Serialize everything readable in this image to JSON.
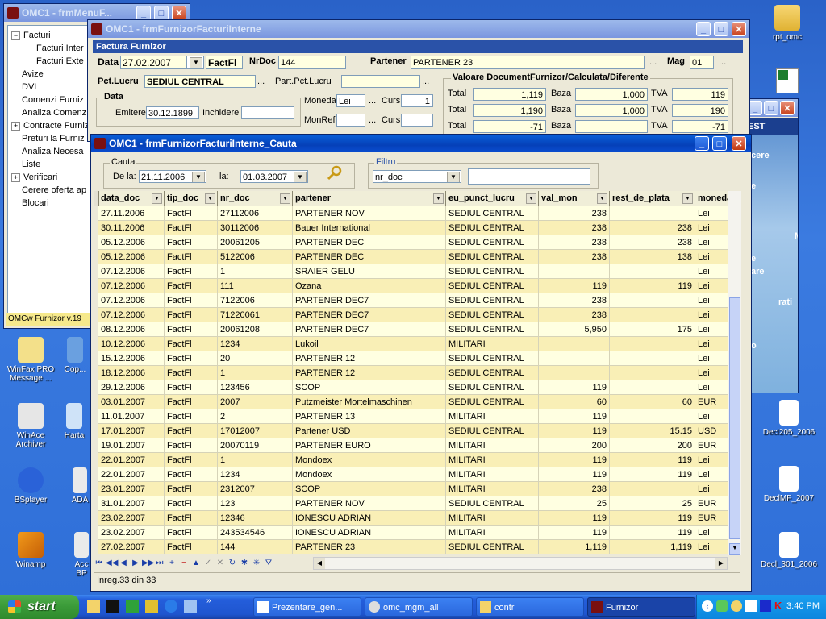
{
  "desktop": {
    "icons": [
      {
        "label": "rpt_omc",
        "kind": "folder"
      },
      {
        "label": "WinFax PRO Message ...",
        "kind": "app"
      },
      {
        "label": "Cop...",
        "kind": "app"
      },
      {
        "label": "WinAce Archiver",
        "kind": "app"
      },
      {
        "label": "Harta",
        "kind": "app"
      },
      {
        "label": "BSplayer",
        "kind": "app"
      },
      {
        "label": "ADA",
        "kind": "app"
      },
      {
        "label": "Winamp",
        "kind": "app"
      },
      {
        "label": "Acc BP",
        "kind": "app"
      },
      {
        "label": "Decl205_2006",
        "kind": "doc"
      },
      {
        "label": "DeclMF_2007",
        "kind": "doc"
      },
      {
        "label": "Decl_301_2006",
        "kind": "doc"
      }
    ]
  },
  "menu_window": {
    "title": "OMC1 - frmMenuF...",
    "tree": [
      {
        "label": "Facturi",
        "expander": "−",
        "indent": 0
      },
      {
        "label": "Facturi Inter",
        "expander": "",
        "indent": 1
      },
      {
        "label": "Facturi Exte",
        "expander": "",
        "indent": 1
      },
      {
        "label": "Avize",
        "expander": "",
        "indent": 0
      },
      {
        "label": "DVI",
        "expander": "",
        "indent": 0
      },
      {
        "label": "Comenzi Furniz",
        "expander": "",
        "indent": 0
      },
      {
        "label": "Analiza Comenz",
        "expander": "",
        "indent": 0
      },
      {
        "label": "Contracte Furniz",
        "expander": "+",
        "indent": 0
      },
      {
        "label": "Preturi la Furniz",
        "expander": "",
        "indent": 0
      },
      {
        "label": "Analiza Necesa",
        "expander": "",
        "indent": 0
      },
      {
        "label": "Liste",
        "expander": "",
        "indent": 0
      },
      {
        "label": "Verificari",
        "expander": "+",
        "indent": 0
      },
      {
        "label": "Cerere oferta ap",
        "expander": "",
        "indent": 0
      },
      {
        "label": "Blocari",
        "expander": "",
        "indent": 0
      }
    ],
    "status": "OMCw Furnizor v.19"
  },
  "test_window": {
    "title_fragment": "EST",
    "items": [
      "cere",
      "e",
      "M",
      "e",
      "are",
      "rati",
      "o"
    ]
  },
  "factura_window": {
    "title": "OMC1 - frmFurnizorFacturiInterne",
    "section": "Factura Furnizor",
    "data_label": "Data",
    "data_value": "27.02.2007",
    "tip_value": "FactFl",
    "nrdoc_label": "NrDoc",
    "nrdoc_value": "144",
    "partener_label": "Partener",
    "partener_value": "PARTENER 23",
    "mag_label": "Mag",
    "mag_value": "01",
    "pct_lucru_label": "Pct.Lucru",
    "pct_lucru_value": "SEDIUL CENTRAL",
    "part_pct_lucru_label": "Part.Pct.Lucru",
    "part_pct_lucru_value": "",
    "data_group": "Data",
    "emitere_label": "Emitere",
    "emitere_value": "30.12.1899",
    "inchidere_label": "Inchidere",
    "inchidere_value": "",
    "moneda_label": "Moneda",
    "moneda_value": "Lei",
    "curs_label": "Curs",
    "curs_value": "1",
    "monref_label": "MonRef",
    "monref_value": "",
    "curs2_label": "Curs",
    "curs2_value": "",
    "valoare_title": "Valoare DocumentFurnizor/Calculata/Diferente",
    "total_label": "Total",
    "baza_label": "Baza",
    "tva_label": "TVA",
    "valori": [
      {
        "total": "1,119",
        "baza": "1,000",
        "tva": "119"
      },
      {
        "total": "1,190",
        "baza": "1,000",
        "tva": "190"
      },
      {
        "total": "-71",
        "baza": "",
        "tva": "-71"
      }
    ]
  },
  "cauta_window": {
    "title": "OMC1 - frmFurnizorFacturiInterne_Cauta",
    "cauta_group": "Cauta",
    "de_la_label": "De la:",
    "de_la_value": "21.11.2006",
    "la_label": "la:",
    "la_value": "01.03.2007",
    "filtru_group": "Filtru",
    "filtru_field": "nr_doc",
    "filtru_value": "",
    "columns": [
      "data_doc",
      "tip_doc",
      "nr_doc",
      "partener",
      "eu_punct_lucru",
      "val_mon",
      "rest_de_plata",
      "moneda"
    ],
    "rows": [
      [
        "27.11.2006",
        "FactFl",
        "27112006",
        "PARTENER NOV",
        "SEDIUL CENTRAL",
        "238",
        "",
        "Lei"
      ],
      [
        "30.11.2006",
        "FactFl",
        "30112006",
        "Bauer International",
        "SEDIUL CENTRAL",
        "238",
        "238",
        "Lei"
      ],
      [
        "05.12.2006",
        "FactFl",
        "20061205",
        "PARTENER DEC",
        "SEDIUL CENTRAL",
        "238",
        "238",
        "Lei"
      ],
      [
        "05.12.2006",
        "FactFl",
        "5122006",
        "PARTENER DEC",
        "SEDIUL CENTRAL",
        "238",
        "138",
        "Lei"
      ],
      [
        "07.12.2006",
        "FactFl",
        "1",
        "SRAIER GELU",
        "SEDIUL CENTRAL",
        "",
        "",
        "Lei"
      ],
      [
        "07.12.2006",
        "FactFl",
        "111",
        "Ozana",
        "SEDIUL CENTRAL",
        "119",
        "119",
        "Lei"
      ],
      [
        "07.12.2006",
        "FactFl",
        "7122006",
        "PARTENER DEC7",
        "SEDIUL CENTRAL",
        "238",
        "",
        "Lei"
      ],
      [
        "07.12.2006",
        "FactFl",
        "71220061",
        "PARTENER DEC7",
        "SEDIUL CENTRAL",
        "238",
        "",
        "Lei"
      ],
      [
        "08.12.2006",
        "FactFl",
        "20061208",
        "PARTENER DEC7",
        "SEDIUL CENTRAL",
        "5,950",
        "175",
        "Lei"
      ],
      [
        "10.12.2006",
        "FactFl",
        "1234",
        "Lukoil",
        "MILITARI",
        "",
        "",
        "Lei"
      ],
      [
        "15.12.2006",
        "FactFl",
        "20",
        "PARTENER 12",
        "SEDIUL CENTRAL",
        "",
        "",
        "Lei"
      ],
      [
        "18.12.2006",
        "FactFl",
        "1",
        "PARTENER 12",
        "SEDIUL CENTRAL",
        "",
        "",
        "Lei"
      ],
      [
        "29.12.2006",
        "FactFl",
        "123456",
        "SCOP",
        "SEDIUL CENTRAL",
        "119",
        "",
        "Lei"
      ],
      [
        "03.01.2007",
        "FactFl",
        "2007",
        "Putzmeister Mortelmaschinen",
        "SEDIUL CENTRAL",
        "60",
        "60",
        "EUR"
      ],
      [
        "11.01.2007",
        "FactFl",
        "2",
        "PARTENER 13",
        "MILITARI",
        "119",
        "",
        "Lei"
      ],
      [
        "17.01.2007",
        "FactFl",
        "17012007",
        "Partener USD",
        "SEDIUL CENTRAL",
        "119",
        "15.15",
        "USD"
      ],
      [
        "19.01.2007",
        "FactFl",
        "20070119",
        "PARTENER EURO",
        "MILITARI",
        "200",
        "200",
        "EUR"
      ],
      [
        "22.01.2007",
        "FactFl",
        "1",
        "Mondoex",
        "MILITARI",
        "119",
        "119",
        "Lei"
      ],
      [
        "22.01.2007",
        "FactFl",
        "1234",
        "Mondoex",
        "MILITARI",
        "119",
        "119",
        "Lei"
      ],
      [
        "23.01.2007",
        "FactFl",
        "2312007",
        "SCOP",
        "MILITARI",
        "238",
        "",
        "Lei"
      ],
      [
        "31.01.2007",
        "FactFl",
        "123",
        "PARTENER NOV",
        "SEDIUL CENTRAL",
        "25",
        "25",
        "EUR"
      ],
      [
        "23.02.2007",
        "FactFl",
        "12346",
        "IONESCU ADRIAN",
        "MILITARI",
        "119",
        "119",
        "EUR"
      ],
      [
        "23.02.2007",
        "FactFl",
        "243534546",
        "IONESCU ADRIAN",
        "MILITARI",
        "119",
        "119",
        "Lei"
      ],
      [
        "27.02.2007",
        "FactFl",
        "144",
        "PARTENER 23",
        "SEDIUL CENTRAL",
        "1,119",
        "1,119",
        "Lei"
      ]
    ],
    "status": "Inreg.33 din 33"
  },
  "taskbar": {
    "start_label": "start",
    "buttons": [
      {
        "label": "Prezentare_gen...",
        "active": false
      },
      {
        "label": "omc_mgm_all",
        "active": false
      },
      {
        "label": "contr",
        "active": false
      },
      {
        "label": "Furnizor",
        "active": true
      }
    ],
    "clock": "3:40 PM"
  }
}
